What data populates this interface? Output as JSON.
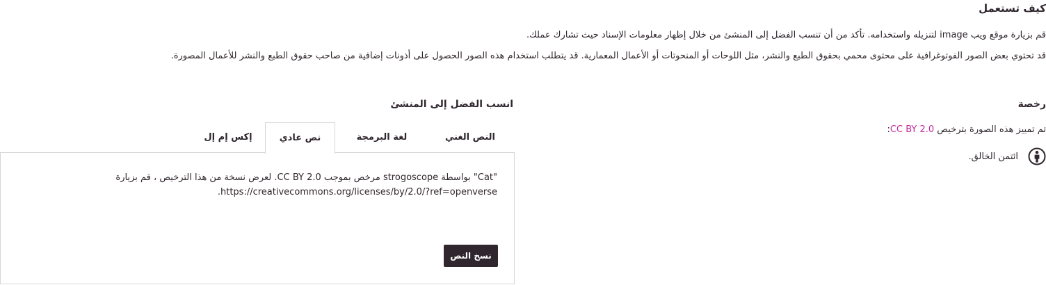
{
  "how_to_use": {
    "title": "كيف تستعمل",
    "paragraph1": "قم بزيارة موقع ويب image لتنزيله واستخدامه. تأكد من أن تنسب الفضل إلى المنشئ من خلال إظهار معلومات الإسناد حيث تشارك عملك.",
    "paragraph2": "قد تحتوي بعض الصور الفوتوغرافية على محتوى محمي بحقوق الطبع والنشر، مثل اللوحات أو المنحوتات أو الأعمال المعمارية. قد يتطلب استخدام هذه الصور الحصول على أذونات إضافية من صاحب حقوق الطبع والنشر للأعمال المصورة."
  },
  "license": {
    "title": "رخصة",
    "line_prefix": "تم تمييز هذه الصورة بترخيص ",
    "license_name": "CC BY 2.0",
    "line_suffix": ":",
    "by_text": "ائتمن الخالق.",
    "by_icon": "cc-by-person-icon"
  },
  "attribution": {
    "title": "انسب الفضل إلى المنشئ",
    "tabs": {
      "rich": "النص الغني",
      "html": "لغة البرمجة",
      "plain": "نص عادي",
      "xml": "إكس إم إل"
    },
    "active_tab": "plain",
    "text": "\"Cat\" بواسطة strogoscope مرخص بموجب CC BY 2.0. لعرض نسخة من هذا الترخيص ، قم بزيارة https://creativecommons.org/licenses/by/2.0/?ref=openverse.",
    "copy_button": "نسخ النص"
  },
  "colors": {
    "text": "#30272e",
    "link": "#c52b9b",
    "border": "#d8d4d8",
    "button_bg": "#30272e"
  }
}
